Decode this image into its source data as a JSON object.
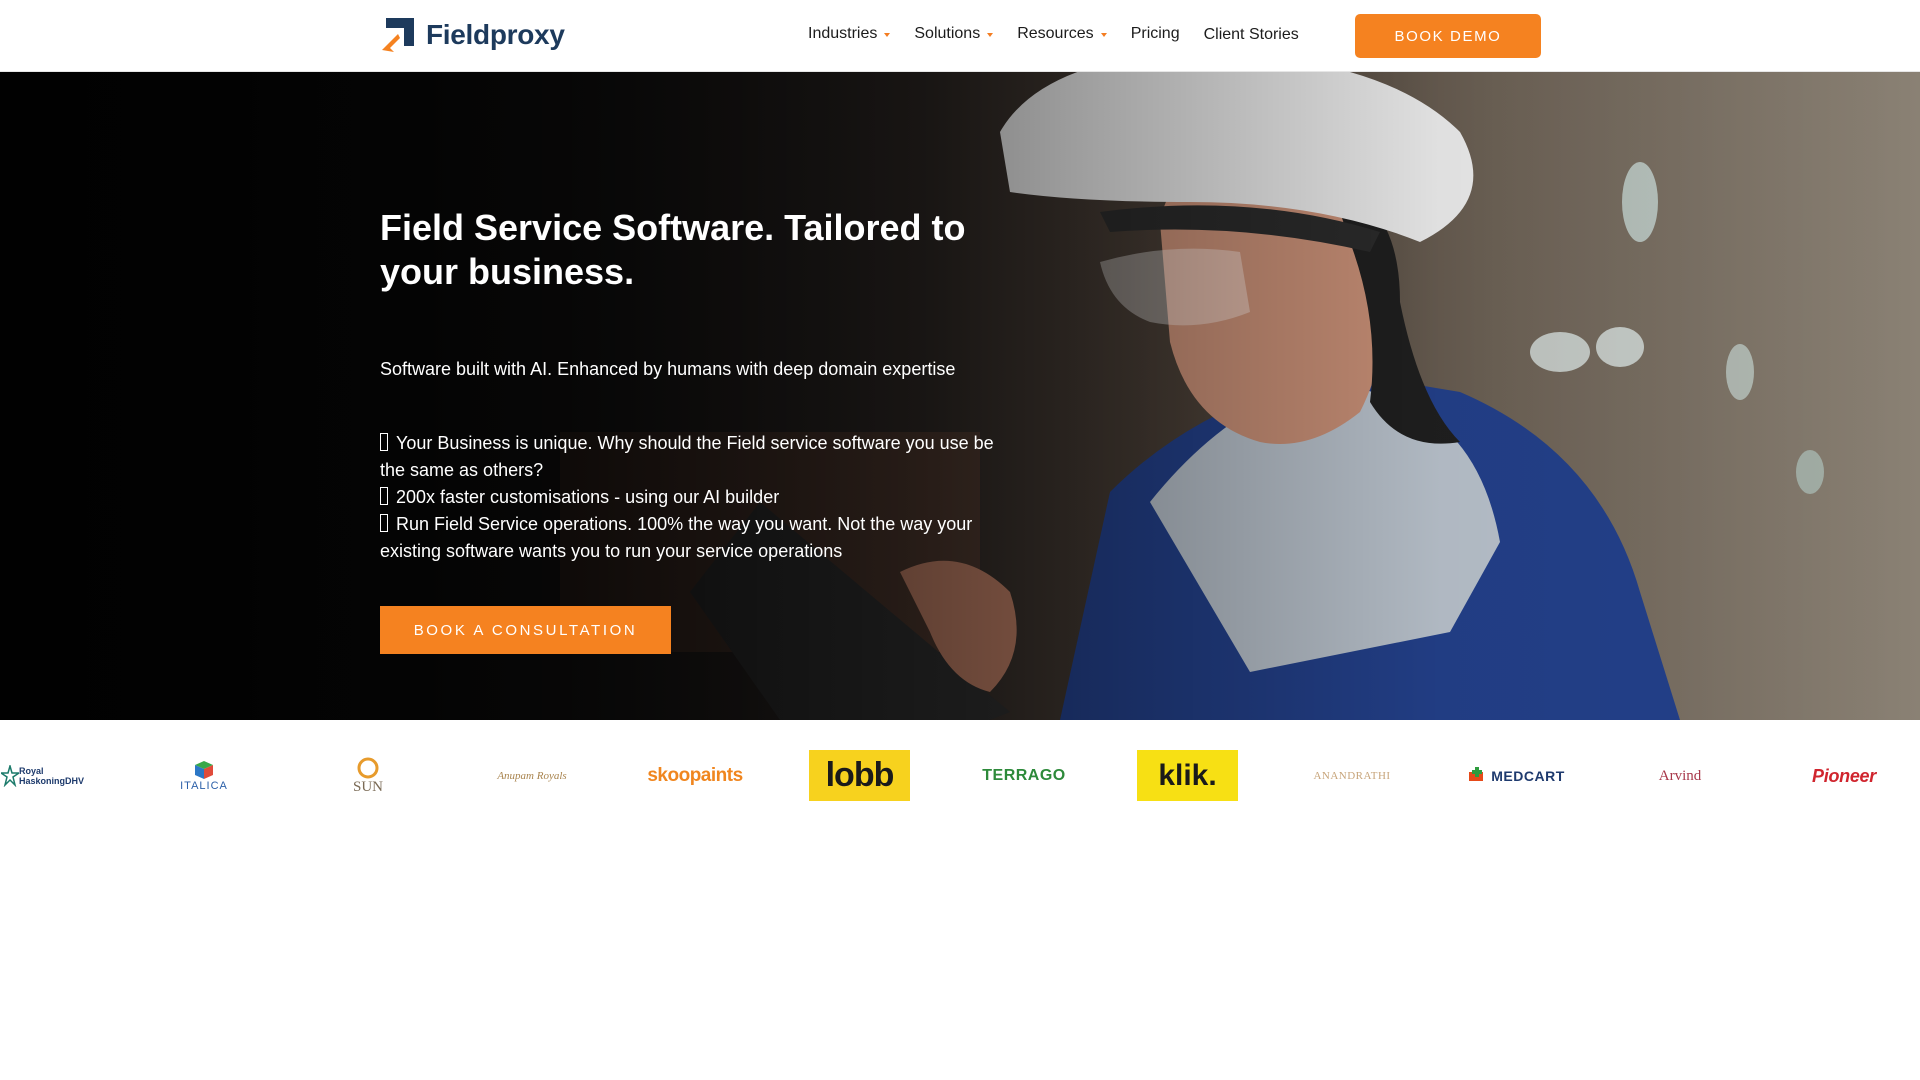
{
  "header": {
    "brand": "Fieldproxy",
    "nav": [
      {
        "label": "Industries",
        "dropdown": true
      },
      {
        "label": "Solutions",
        "dropdown": true
      },
      {
        "label": "Resources",
        "dropdown": true
      },
      {
        "label": "Pricing",
        "dropdown": false
      },
      {
        "label": "Client Stories",
        "dropdown": false
      }
    ],
    "cta_label": "BOOK DEMO"
  },
  "hero": {
    "title": "Field Service Software. Tailored to your business.",
    "subtitle": "Software built with AI. Enhanced by humans with deep domain expertise",
    "bullets": [
      "Your Business is unique. Why should the Field service software you use be the same as others?",
      "200x faster customisations - using our AI builder",
      "Run Field Service operations. 100% the way you want. Not the way your existing software wants you to run your service operations"
    ],
    "cta_label": "BOOK A CONSULTATION"
  },
  "clients": [
    {
      "name": "Royal HaskoningDHV",
      "text": "Royal HaskoningDHV"
    },
    {
      "name": "Italica",
      "text": "ITALICA"
    },
    {
      "name": "Sun Pharma",
      "text": "SUN"
    },
    {
      "name": "Anupam Royals",
      "text": "Anupam Royals"
    },
    {
      "name": "Skoo Paints",
      "text": "skoopaints"
    },
    {
      "name": "Lobb",
      "text": "lobb"
    },
    {
      "name": "Terrago",
      "text": "TERRAGO"
    },
    {
      "name": "Klik",
      "text": "klik."
    },
    {
      "name": "Anand Rathi",
      "text": "ANANDRATHI"
    },
    {
      "name": "Medcart",
      "text": "MEDCART"
    },
    {
      "name": "Arvind Fashions",
      "text": "Arvind"
    },
    {
      "name": "Pioneer",
      "text": "Pioneer"
    }
  ],
  "colors": {
    "accent": "#f58220",
    "brand": "#1d3a5c"
  }
}
